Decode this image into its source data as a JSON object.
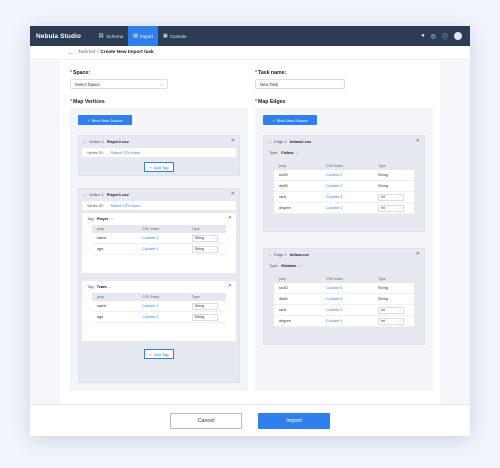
{
  "app": {
    "brand": "Nebula Studio"
  },
  "nav": [
    {
      "label": "Schema"
    },
    {
      "label": "Import"
    },
    {
      "label": "Console"
    }
  ],
  "breadcrumb": {
    "parent": "Task list",
    "sep": "/",
    "current": "Create New Import task"
  },
  "form": {
    "space_label": "Space:",
    "space_value": "Select Space",
    "task_label": "Task name:",
    "task_value": "New Task"
  },
  "vertices": {
    "title": "Map Vertices",
    "bind_button": "Bind New Source",
    "items": [
      {
        "index": "Vertex 2",
        "file": "Player2.csv",
        "id_label": "Vertex ID:",
        "id_link": "Select CSV Index",
        "add_tag": "Add Tag"
      },
      {
        "index": "Vertex 1",
        "file": "Player1.csv",
        "id_label": "Vertex ID:",
        "id_link": "Select CSV Index",
        "add_tag": "Add Tag",
        "tags": [
          {
            "tag_label": "Tag:",
            "tag_value": "Player",
            "cols": [
              "prop",
              "CSV Index",
              "Type"
            ],
            "rows": [
              {
                "prop": "name",
                "index": "Column 2",
                "type": "String"
              },
              {
                "prop": "age",
                "index": "Column 1",
                "type": "String"
              }
            ]
          },
          {
            "tag_label": "Tag:",
            "tag_value": "Team",
            "cols": [
              "prop",
              "CSV Index",
              "Type"
            ],
            "rows": [
              {
                "prop": "name",
                "index": "Column 2",
                "type": "String"
              },
              {
                "prop": "age",
                "index": "Column 1",
                "type": "String"
              }
            ]
          }
        ]
      }
    ]
  },
  "edges": {
    "title": "Map Edges",
    "bind_button": "Bind New Source",
    "items": [
      {
        "index": "Edge 2",
        "file": "follow2.csv",
        "type_label": "Type:",
        "type_value": "Follow",
        "cols": [
          "prop",
          "CSV Index",
          "Type"
        ],
        "rows": [
          {
            "prop": "srcID",
            "index": "Column 2",
            "type": "String"
          },
          {
            "prop": "dstID",
            "index": "Column 0",
            "type": "String"
          },
          {
            "prop": "rank",
            "index": "Column 3",
            "type": "int"
          },
          {
            "prop": "degree",
            "index": "Column 1",
            "type": "int"
          }
        ]
      },
      {
        "index": "Edge 1",
        "file": "follow.csv",
        "type_label": "Type:",
        "type_value": "Relation",
        "cols": [
          "prop",
          "CSV Index",
          "Type"
        ],
        "rows": [
          {
            "prop": "srcID",
            "index": "Column 0",
            "type": "String"
          },
          {
            "prop": "dstID",
            "index": "Column 0",
            "type": "String"
          },
          {
            "prop": "rank",
            "index": "Column 2",
            "type": "int"
          },
          {
            "prop": "degree",
            "index": "Column 1",
            "type": "int"
          }
        ]
      }
    ]
  },
  "footer": {
    "cancel": "Cancel",
    "import": "Import"
  },
  "colors": {
    "accent": "#2f80ed",
    "topbar": "#2e3c53"
  }
}
